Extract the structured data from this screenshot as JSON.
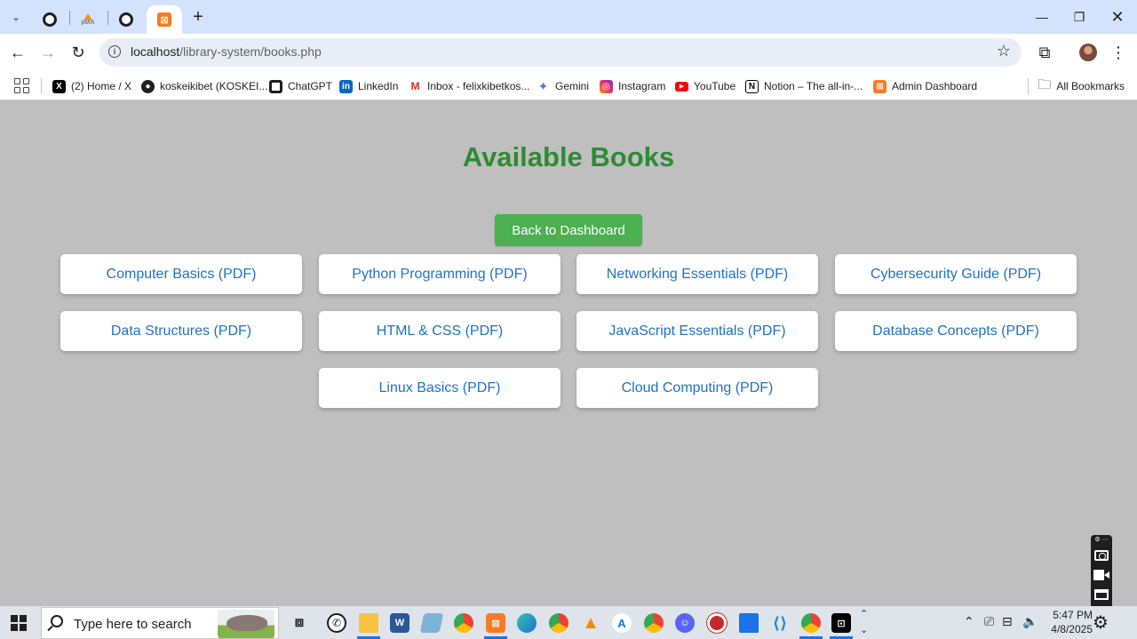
{
  "browser": {
    "tabs": [
      {
        "icon": "openai-icon"
      },
      {
        "icon": "phpmyadmin-icon"
      },
      {
        "icon": "openai-icon"
      },
      {
        "icon": "xampp-icon",
        "active": true
      }
    ],
    "url_host": "localhost",
    "url_path": "/library-system/books.php"
  },
  "bookmarks": [
    {
      "label": "(2) Home / X",
      "icon": "x-icon"
    },
    {
      "label": "koskeikibet (KOSKEI...",
      "icon": "github-icon"
    },
    {
      "label": "ChatGPT",
      "icon": "openai-icon"
    },
    {
      "label": "LinkedIn",
      "icon": "linkedin-icon"
    },
    {
      "label": "Inbox - felixkibetkos...",
      "icon": "gmail-icon"
    },
    {
      "label": "Gemini",
      "icon": "gemini-icon"
    },
    {
      "label": "Instagram",
      "icon": "instagram-icon"
    },
    {
      "label": "YouTube",
      "icon": "youtube-icon"
    },
    {
      "label": "Notion – The all-in-...",
      "icon": "notion-icon"
    },
    {
      "label": "Admin Dashboard",
      "icon": "xampp-icon"
    }
  ],
  "all_bookmarks_label": "All Bookmarks",
  "page": {
    "title": "Available Books",
    "back_button": "Back to Dashboard",
    "books": [
      "Computer Basics (PDF)",
      "Python Programming (PDF)",
      "Networking Essentials (PDF)",
      "Cybersecurity Guide (PDF)",
      "Data Structures (PDF)",
      "HTML & CSS (PDF)",
      "JavaScript Essentials (PDF)",
      "Database Concepts (PDF)",
      "Linux Basics (PDF)",
      "Cloud Computing (PDF)"
    ]
  },
  "colors": {
    "page_bg": "#bfbfbf",
    "title": "#2e8b34",
    "button": "#4caf50",
    "link": "#1f72c4"
  },
  "taskbar": {
    "search_placeholder": "Type here to search",
    "time": "5:47 PM",
    "date": "4/8/2025"
  }
}
